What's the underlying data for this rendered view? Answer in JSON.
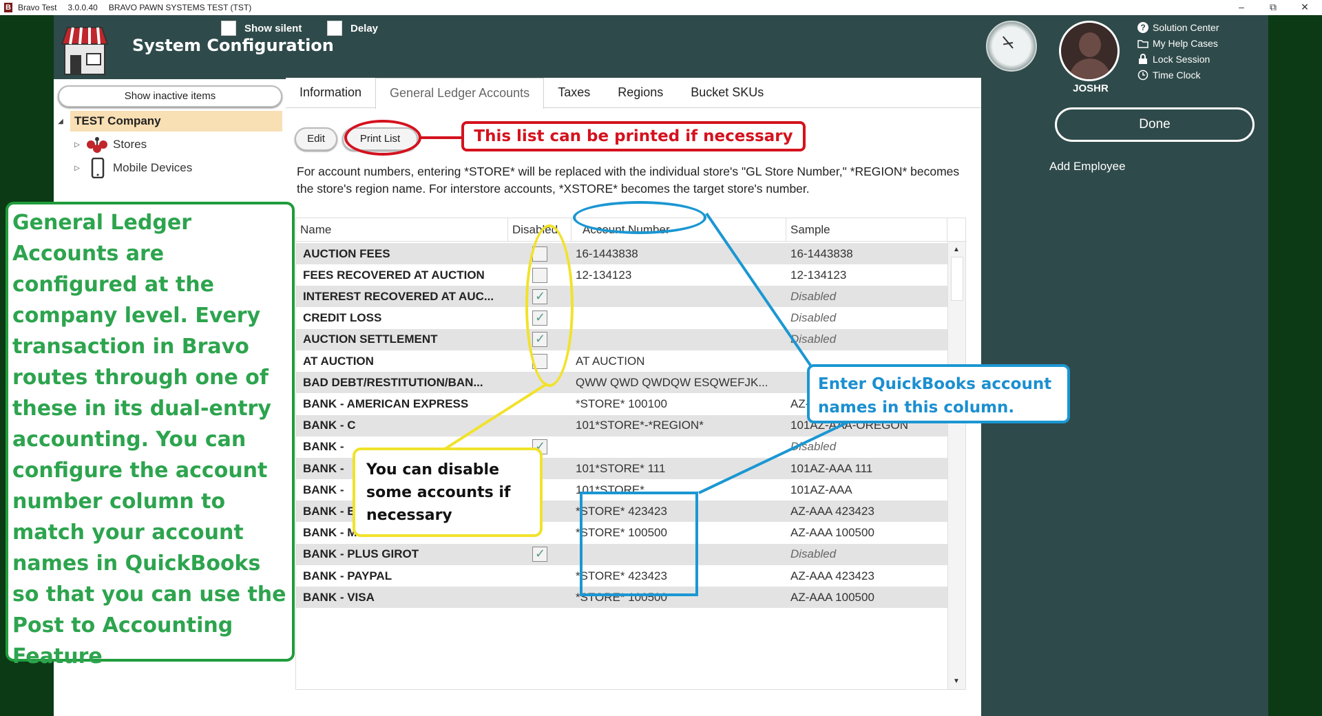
{
  "titlebar": {
    "app_name": "Bravo Test",
    "version": "3.0.0.40",
    "system": "BRAVO PAWN SYSTEMS TEST (TST)",
    "minimize": "–",
    "maximize": "⧉",
    "close": "✕"
  },
  "header": {
    "title": "System Configuration",
    "show_silent_label": "Show silent",
    "delay_label": "Delay",
    "username": "JOSHR",
    "links": [
      "Solution Center",
      "My Help Cases",
      "Lock Session",
      "Time Clock"
    ],
    "status_mark": "bot"
  },
  "sidebar": {
    "show_inactive_label": "Show inactive items",
    "tree": [
      {
        "label": "TEST Company",
        "expanded": true,
        "selected": true
      },
      {
        "label": "Stores",
        "icon": "stores-icon"
      },
      {
        "label": "Mobile Devices",
        "icon": "mobile-icon"
      }
    ]
  },
  "tabs": [
    "Information",
    "General Ledger Accounts",
    "Taxes",
    "Regions",
    "Bucket SKUs"
  ],
  "active_tab": "General Ledger Accounts",
  "toolbar": {
    "edit_label": "Edit",
    "print_label": "Print List"
  },
  "note": "For account numbers, entering *STORE* will be replaced with the individual store's \"GL Store Number,\" *REGION* becomes the store's region name. For interstore accounts, *XSTORE* becomes the target store's number.",
  "grid": {
    "columns": [
      "Name",
      "Disabled",
      "Account Number",
      "Sample"
    ],
    "rows": [
      {
        "name": "AUCTION FEES",
        "disabled": false,
        "account": "16-1443838",
        "sample": "16-1443838"
      },
      {
        "name": "FEES RECOVERED AT AUCTION",
        "disabled": false,
        "account": "12-134123",
        "sample": "12-134123"
      },
      {
        "name": "INTEREST RECOVERED AT AUC...",
        "disabled": true,
        "account": "",
        "sample": "Disabled"
      },
      {
        "name": "CREDIT LOSS",
        "disabled": true,
        "account": "",
        "sample": "Disabled"
      },
      {
        "name": "AUCTION SETTLEMENT",
        "disabled": true,
        "account": "",
        "sample": "Disabled"
      },
      {
        "name": "AT AUCTION",
        "disabled": false,
        "account": "AT AUCTION",
        "sample": ""
      },
      {
        "name": "BAD DEBT/RESTITUTION/BAN...",
        "disabled": null,
        "account": "QWW QWD QWDQW ESQWEFJK...",
        "sample": ""
      },
      {
        "name": "BANK - AMERICAN EXPRESS",
        "disabled": null,
        "account": "*STORE* 100100",
        "sample": "AZ-AAA 100100"
      },
      {
        "name": "BANK - C",
        "disabled": null,
        "account": "101*STORE*-*REGION*",
        "sample": "101AZ-AAA-OREGON"
      },
      {
        "name": "BANK -",
        "disabled": true,
        "account": "",
        "sample": "Disabled"
      },
      {
        "name": "BANK -",
        "disabled": null,
        "account": "101*STORE* 111",
        "sample": "101AZ-AAA 111"
      },
      {
        "name": "BANK -",
        "disabled": null,
        "account": "101*STORE*",
        "sample": "101AZ-AAA"
      },
      {
        "name": "BANK - EBAY",
        "disabled": null,
        "account": "*STORE* 423423",
        "sample": "AZ-AAA 423423"
      },
      {
        "name": "BANK - MASTERCARD",
        "disabled": null,
        "account": "*STORE* 100500",
        "sample": "AZ-AAA 100500"
      },
      {
        "name": "BANK - PLUS GIROT",
        "disabled": true,
        "account": "",
        "sample": "Disabled"
      },
      {
        "name": "BANK - PAYPAL",
        "disabled": null,
        "account": "*STORE* 423423",
        "sample": "AZ-AAA 423423"
      },
      {
        "name": "BANK - VISA",
        "disabled": null,
        "account": "*STORE* 100500",
        "sample": "AZ-AAA 100500"
      }
    ]
  },
  "right": {
    "done_label": "Done",
    "add_employee_label": "Add Employee"
  },
  "annotations": {
    "green": "General Ledger Accounts are configured at the company level. Every transaction in Bravo routes through one of these in its dual-entry accounting. You can configure the account number column to match your account names in QuickBooks so that you can use the Post to Accounting Feature",
    "red": "This list can be printed if necessary",
    "yellow": "You can disable some accounts if necessary",
    "blue": "Enter QuickBooks account names in this column."
  }
}
